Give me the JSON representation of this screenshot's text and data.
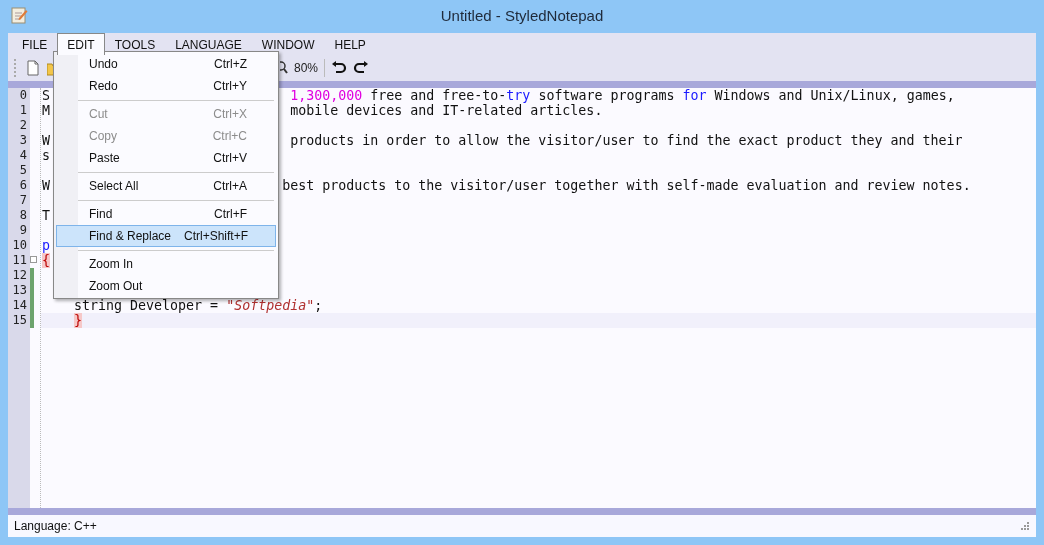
{
  "window": {
    "title": "Untitled - StyledNotepad"
  },
  "menubar": [
    {
      "label": "FILE",
      "selected": false
    },
    {
      "label": "EDIT",
      "selected": true
    },
    {
      "label": "TOOLS",
      "selected": false
    },
    {
      "label": "LANGUAGE",
      "selected": false
    },
    {
      "label": "WINDOW",
      "selected": false
    },
    {
      "label": "HELP",
      "selected": false
    }
  ],
  "toolbar": {
    "zoom": "80%"
  },
  "edit_menu": [
    {
      "kind": "item",
      "label": "Undo",
      "shortcut": "Ctrl+Z",
      "disabled": false,
      "selected": false
    },
    {
      "kind": "item",
      "label": "Redo",
      "shortcut": "Ctrl+Y",
      "disabled": false,
      "selected": false
    },
    {
      "kind": "separator"
    },
    {
      "kind": "item",
      "label": "Cut",
      "shortcut": "Ctrl+X",
      "disabled": true,
      "selected": false
    },
    {
      "kind": "item",
      "label": "Copy",
      "shortcut": "Ctrl+C",
      "disabled": true,
      "selected": false
    },
    {
      "kind": "item",
      "label": "Paste",
      "shortcut": "Ctrl+V",
      "disabled": false,
      "selected": false
    },
    {
      "kind": "separator"
    },
    {
      "kind": "item",
      "label": "Select All",
      "shortcut": "Ctrl+A",
      "disabled": false,
      "selected": false
    },
    {
      "kind": "separator"
    },
    {
      "kind": "item",
      "label": "Find",
      "shortcut": "Ctrl+F",
      "disabled": false,
      "selected": false
    },
    {
      "kind": "item",
      "label": "Find & Replace",
      "shortcut": "Ctrl+Shift+F",
      "disabled": false,
      "selected": true
    },
    {
      "kind": "separator"
    },
    {
      "kind": "item",
      "label": "Zoom In",
      "disabled": false,
      "selected": false
    },
    {
      "kind": "item",
      "label": "Zoom Out",
      "disabled": false,
      "selected": false
    }
  ],
  "editor": {
    "lines": [
      {
        "number": "0",
        "left": [
          {
            "kind": "plain",
            "text": "S"
          }
        ],
        "right": [
          {
            "kind": "number",
            "text": "1,300,000"
          },
          {
            "kind": "plain",
            "text": " free and free-to-"
          },
          {
            "kind": "keyword",
            "text": "try"
          },
          {
            "kind": "plain",
            "text": " software programs "
          },
          {
            "kind": "keyword",
            "text": "for"
          },
          {
            "kind": "plain",
            "text": " Windows and Unix/Linux, games,"
          }
        ]
      },
      {
        "number": "1",
        "left": [
          {
            "kind": "plain",
            "text": "M"
          }
        ],
        "right": [
          {
            "kind": "plain",
            "text": "mobile devices and IT-related articles."
          }
        ]
      },
      {
        "number": "2"
      },
      {
        "number": "3",
        "left": [
          {
            "kind": "plain",
            "text": "W"
          }
        ],
        "right": [
          {
            "kind": "plain",
            "text": "products in order to allow the visitor/user to find the exact product they and their"
          }
        ]
      },
      {
        "number": "4",
        "left": [
          {
            "kind": "plain",
            "text": "s"
          }
        ]
      },
      {
        "number": "5"
      },
      {
        "number": "6",
        "left": [
          {
            "kind": "plain",
            "text": "W"
          }
        ],
        "right": [
          {
            "kind": "plain",
            "text": "best products to the visitor/user together with self-made evaluation and review notes."
          }
        ]
      },
      {
        "number": "7"
      },
      {
        "number": "8",
        "left": [
          {
            "kind": "plain",
            "text": "T"
          }
        ]
      },
      {
        "number": "9"
      },
      {
        "number": "10",
        "left": [
          {
            "kind": "keyword",
            "text": "p"
          }
        ]
      },
      {
        "number": "11",
        "fold": true,
        "left": [
          {
            "kind": "brace",
            "text": "{"
          }
        ]
      },
      {
        "number": "12",
        "changed": true
      },
      {
        "number": "13",
        "changed": true
      },
      {
        "number": "14",
        "changed": true,
        "indent": true,
        "left": [
          {
            "kind": "plain",
            "text": "string Developer = "
          },
          {
            "kind": "string",
            "text": "\"Softpedia\""
          },
          {
            "kind": "plain",
            "text": ";"
          }
        ]
      },
      {
        "number": "15",
        "changed": true,
        "current": true,
        "indent": true,
        "left": [
          {
            "kind": "brace",
            "text": "}"
          }
        ]
      }
    ]
  },
  "status_bar": {
    "language": "Language: C++"
  }
}
